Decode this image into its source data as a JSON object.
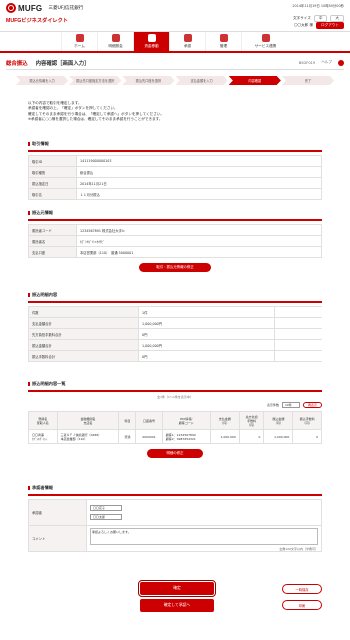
{
  "header": {
    "logo_text": "MUFG",
    "bank": "三菱UFJ信託銀行",
    "brand": "MUFGビジネスダイレクト",
    "datetime": "2014年11月19日 10時50分00秒",
    "charsize": "文字サイズ",
    "size_m": "中",
    "size_l": "大",
    "user": "〇〇太郎 様",
    "logout": "ログアウト"
  },
  "nav": [
    {
      "label": "ホーム",
      "icon": "home-icon"
    },
    {
      "label": "明細照会",
      "icon": "doc-icon"
    },
    {
      "label": "資金移動",
      "icon": "money-icon"
    },
    {
      "label": "承認",
      "icon": "approve-icon"
    },
    {
      "label": "管理",
      "icon": "admin-icon"
    },
    {
      "label": "サービス連携",
      "icon": "link-icon"
    }
  ],
  "page": {
    "main": "総合振込",
    "sub": "内容確認［画面入力］",
    "code": "BSGF019",
    "help": "ヘルプ"
  },
  "steps": [
    "振込元情報を入力",
    "振込先口座指定方法を選択",
    "振込先口座を選択",
    "支払金額を入力",
    "内容確認",
    "完了"
  ],
  "intro": [
    "以下の内容で取引を確定します。",
    "承認者を確認の上、「確定」ボタンを押してください。",
    "確定してそのまま承認を行う場合は、「確定して承認へ」ボタンを押してください。",
    "※承認者に○○様を選択した場合は、確定してそのまま承認を行うことができます。"
  ],
  "trade": {
    "title": "取引情報",
    "rows": [
      [
        "取引ID",
        "141119000000103"
      ],
      [
        "取引種別",
        "総合振込"
      ],
      [
        "振込指定日",
        "2014年11月21日"
      ],
      [
        "取引名",
        "１１月分振込"
      ]
    ]
  },
  "source": {
    "title": "振込元情報",
    "rows": [
      [
        "委託者コード",
        "1234567891 株式会社大手ｂ"
      ],
      [
        "委託者名",
        "ｶﾌﾞｼｷｶﾞｲｼｬｵｵﾃﾋﾞ"
      ],
      [
        "支払口座",
        "本店営業部（110）　普通 5000001"
      ]
    ],
    "edit": "取引・振込元情報の修正"
  },
  "summary": {
    "title": "振込明細内容",
    "rows": [
      [
        "件数",
        "1件"
      ],
      [
        "支払金額合計",
        "1,000,000円"
      ],
      [
        "先方負担手数料合計",
        "0円"
      ],
      [
        "振込金額合計",
        "1,000,000円"
      ],
      [
        "振込手数料合計",
        "0円"
      ]
    ]
  },
  "detail": {
    "title": "振込明細内容一覧",
    "count": "全1件（1～1件を表示中）",
    "disp_label": "表示件数",
    "disp_value": "10件",
    "reorder": "再表示",
    "headers": [
      "登録名\n受取人名",
      "金融機関名\n支店名",
      "科目",
      "口座番号",
      "EDI情報/\n顧客コード",
      "支払金額\n（円）",
      "先方負担\n手数料\n（円）",
      "振込金額\n（円）",
      "振込手数料\n（円）"
    ],
    "rows": [
      {
        "name": "〇〇商事\nｶﾌﾞｼｷｶﾞｲｼｬ",
        "bank": "三菱ＵＦＪ信託銀行（0288）\n本店営業部（110）",
        "type": "普通",
        "acct": "0000001",
        "edi": "顧客1：1234567890\n顧客2：0987654321",
        "pay": "1,000,000",
        "sfee": "0",
        "amt": "1,000,000",
        "fee": "0"
      }
    ],
    "edit": "明細の修正"
  },
  "approver": {
    "title": "承認者情報",
    "label": "承認者",
    "a1": "〇〇花子",
    "a2": "〇〇太郎",
    "comment_label": "コメント",
    "comment": "承認よろしくお願いします。",
    "counter": "全角120文字以内［半角可］"
  },
  "buttons": {
    "confirm": "確定",
    "confirm_approve": "確定して承認へ",
    "save": "一時保存",
    "print": "印刷"
  }
}
